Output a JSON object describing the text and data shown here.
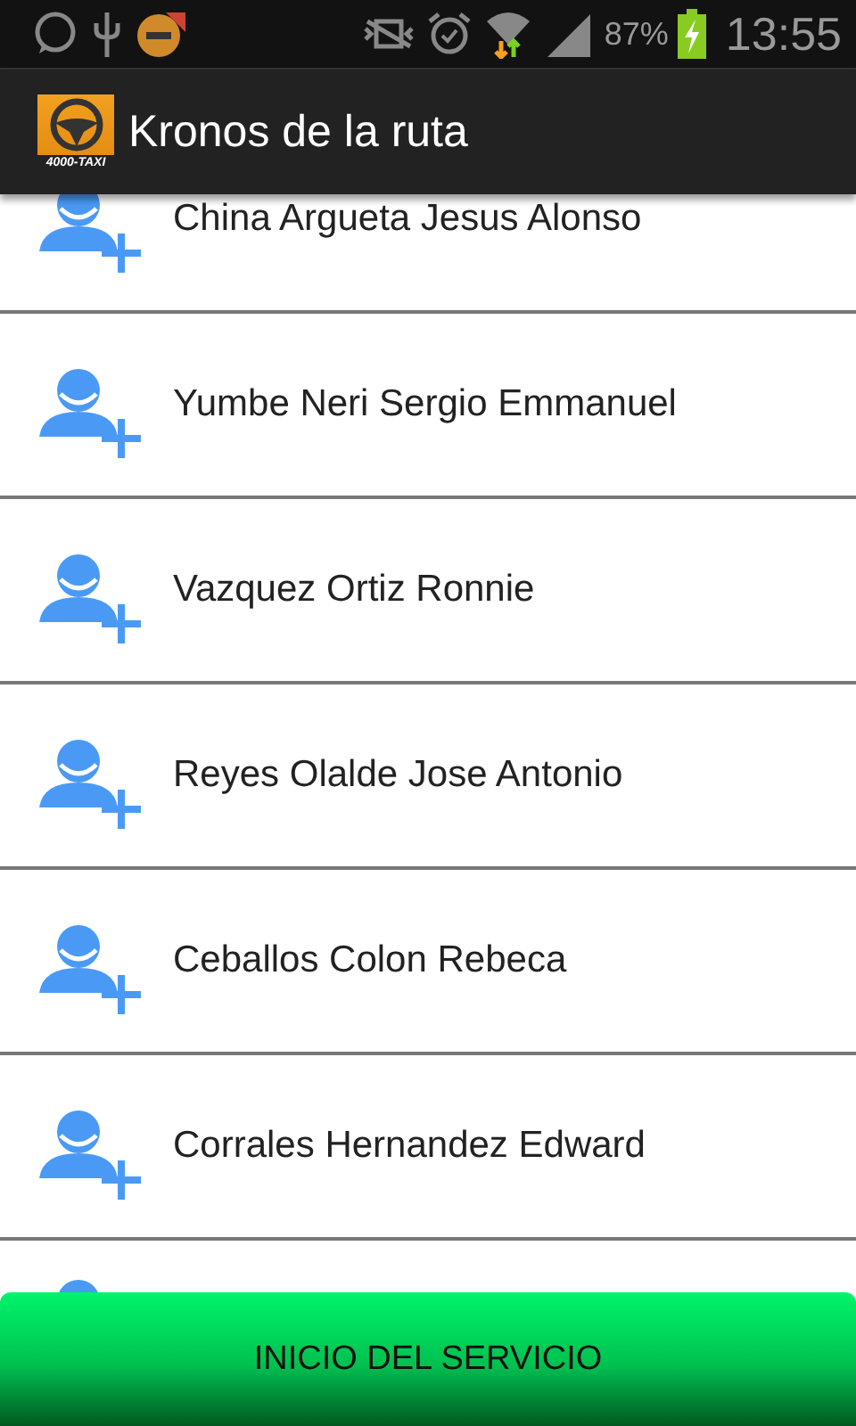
{
  "status_bar": {
    "battery": "87%",
    "time": "13:55"
  },
  "app_bar": {
    "logo_text": "4000-TAXI",
    "title": "Kronos de la ruta"
  },
  "contacts": [
    {
      "name": "China Argueta Jesus Alonso"
    },
    {
      "name": "Yumbe Neri Sergio Emmanuel"
    },
    {
      "name": "Vazquez Ortiz Ronnie"
    },
    {
      "name": "Reyes Olalde Jose Antonio"
    },
    {
      "name": "Ceballos Colon Rebeca"
    },
    {
      "name": "Corrales Hernandez Edward"
    }
  ],
  "action_button": {
    "label": "INICIO DEL SERVICIO"
  }
}
